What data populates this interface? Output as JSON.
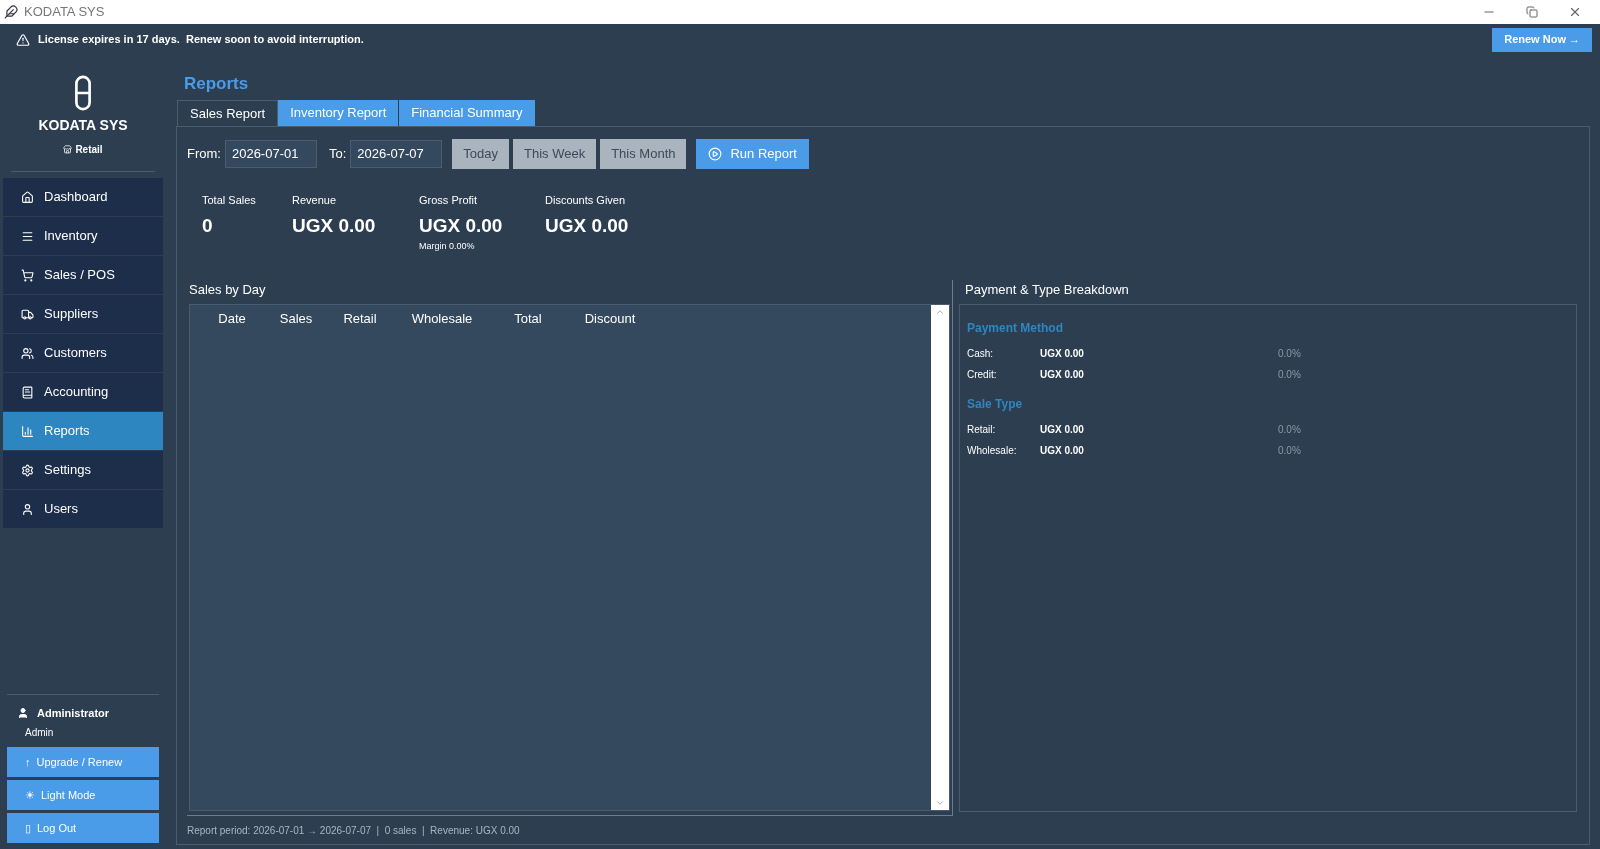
{
  "window": {
    "title": "KODATA SYS"
  },
  "banner": {
    "message": "License expires in 17 days.  Renew soon to avoid interruption.",
    "button": "Renew Now →"
  },
  "sidebar": {
    "app_name": "KODATA SYS",
    "edition": "Retail",
    "items": [
      {
        "label": "Dashboard",
        "selected": false
      },
      {
        "label": "Inventory",
        "selected": false
      },
      {
        "label": "Sales / POS",
        "selected": false
      },
      {
        "label": "Suppliers",
        "selected": false
      },
      {
        "label": "Customers",
        "selected": false
      },
      {
        "label": "Accounting",
        "selected": false
      },
      {
        "label": "Reports",
        "selected": true
      },
      {
        "label": "Settings",
        "selected": false
      },
      {
        "label": "Users",
        "selected": false
      }
    ],
    "user": {
      "name": "Administrator",
      "role": "Admin"
    },
    "buttons": [
      {
        "label": "Upgrade / Renew",
        "icon": "↑"
      },
      {
        "label": "Light Mode",
        "icon": "☀"
      },
      {
        "label": "Log Out",
        "icon": "▯"
      }
    ]
  },
  "page_title": "Reports",
  "tabs": [
    {
      "label": "Sales Report",
      "selected": true
    },
    {
      "label": "Inventory Report",
      "selected": false
    },
    {
      "label": "Financial Summary",
      "selected": false
    }
  ],
  "filters": {
    "from_label": "From:",
    "from_value": "2026-07-01",
    "to_label": "To:",
    "to_value": "2026-07-07",
    "presets": [
      "Today",
      "This Week",
      "This Month"
    ],
    "run_button": "Run Report"
  },
  "stats": [
    {
      "label": "Total Sales",
      "value": "0"
    },
    {
      "label": "Revenue",
      "value": "UGX 0.00"
    },
    {
      "label": "Gross Profit",
      "value": "UGX 0.00",
      "note": "Margin 0.00%"
    },
    {
      "label": "Discounts Given",
      "value": "UGX 0.00"
    }
  ],
  "sales_by_day": {
    "title": "Sales by Day",
    "columns": [
      "Date",
      "Sales",
      "Retail",
      "Wholesale",
      "Total",
      "Discount"
    ]
  },
  "breakdown": {
    "title": "Payment & Type Breakdown",
    "sections": [
      {
        "heading": "Payment Method",
        "rows": [
          {
            "label": "Cash:",
            "amount": "UGX 0.00",
            "percent": "0.0%"
          },
          {
            "label": "Credit:",
            "amount": "UGX 0.00",
            "percent": "0.0%"
          }
        ]
      },
      {
        "heading": "Sale Type",
        "rows": [
          {
            "label": "Retail:",
            "amount": "UGX 0.00",
            "percent": "0.0%"
          },
          {
            "label": "Wholesale:",
            "amount": "UGX 0.00",
            "percent": "0.0%"
          }
        ]
      }
    ]
  },
  "status_bar": "Report period: 2026-07-01 → 2026-07-07  |  0 sales  |  Revenue: UGX 0.00"
}
